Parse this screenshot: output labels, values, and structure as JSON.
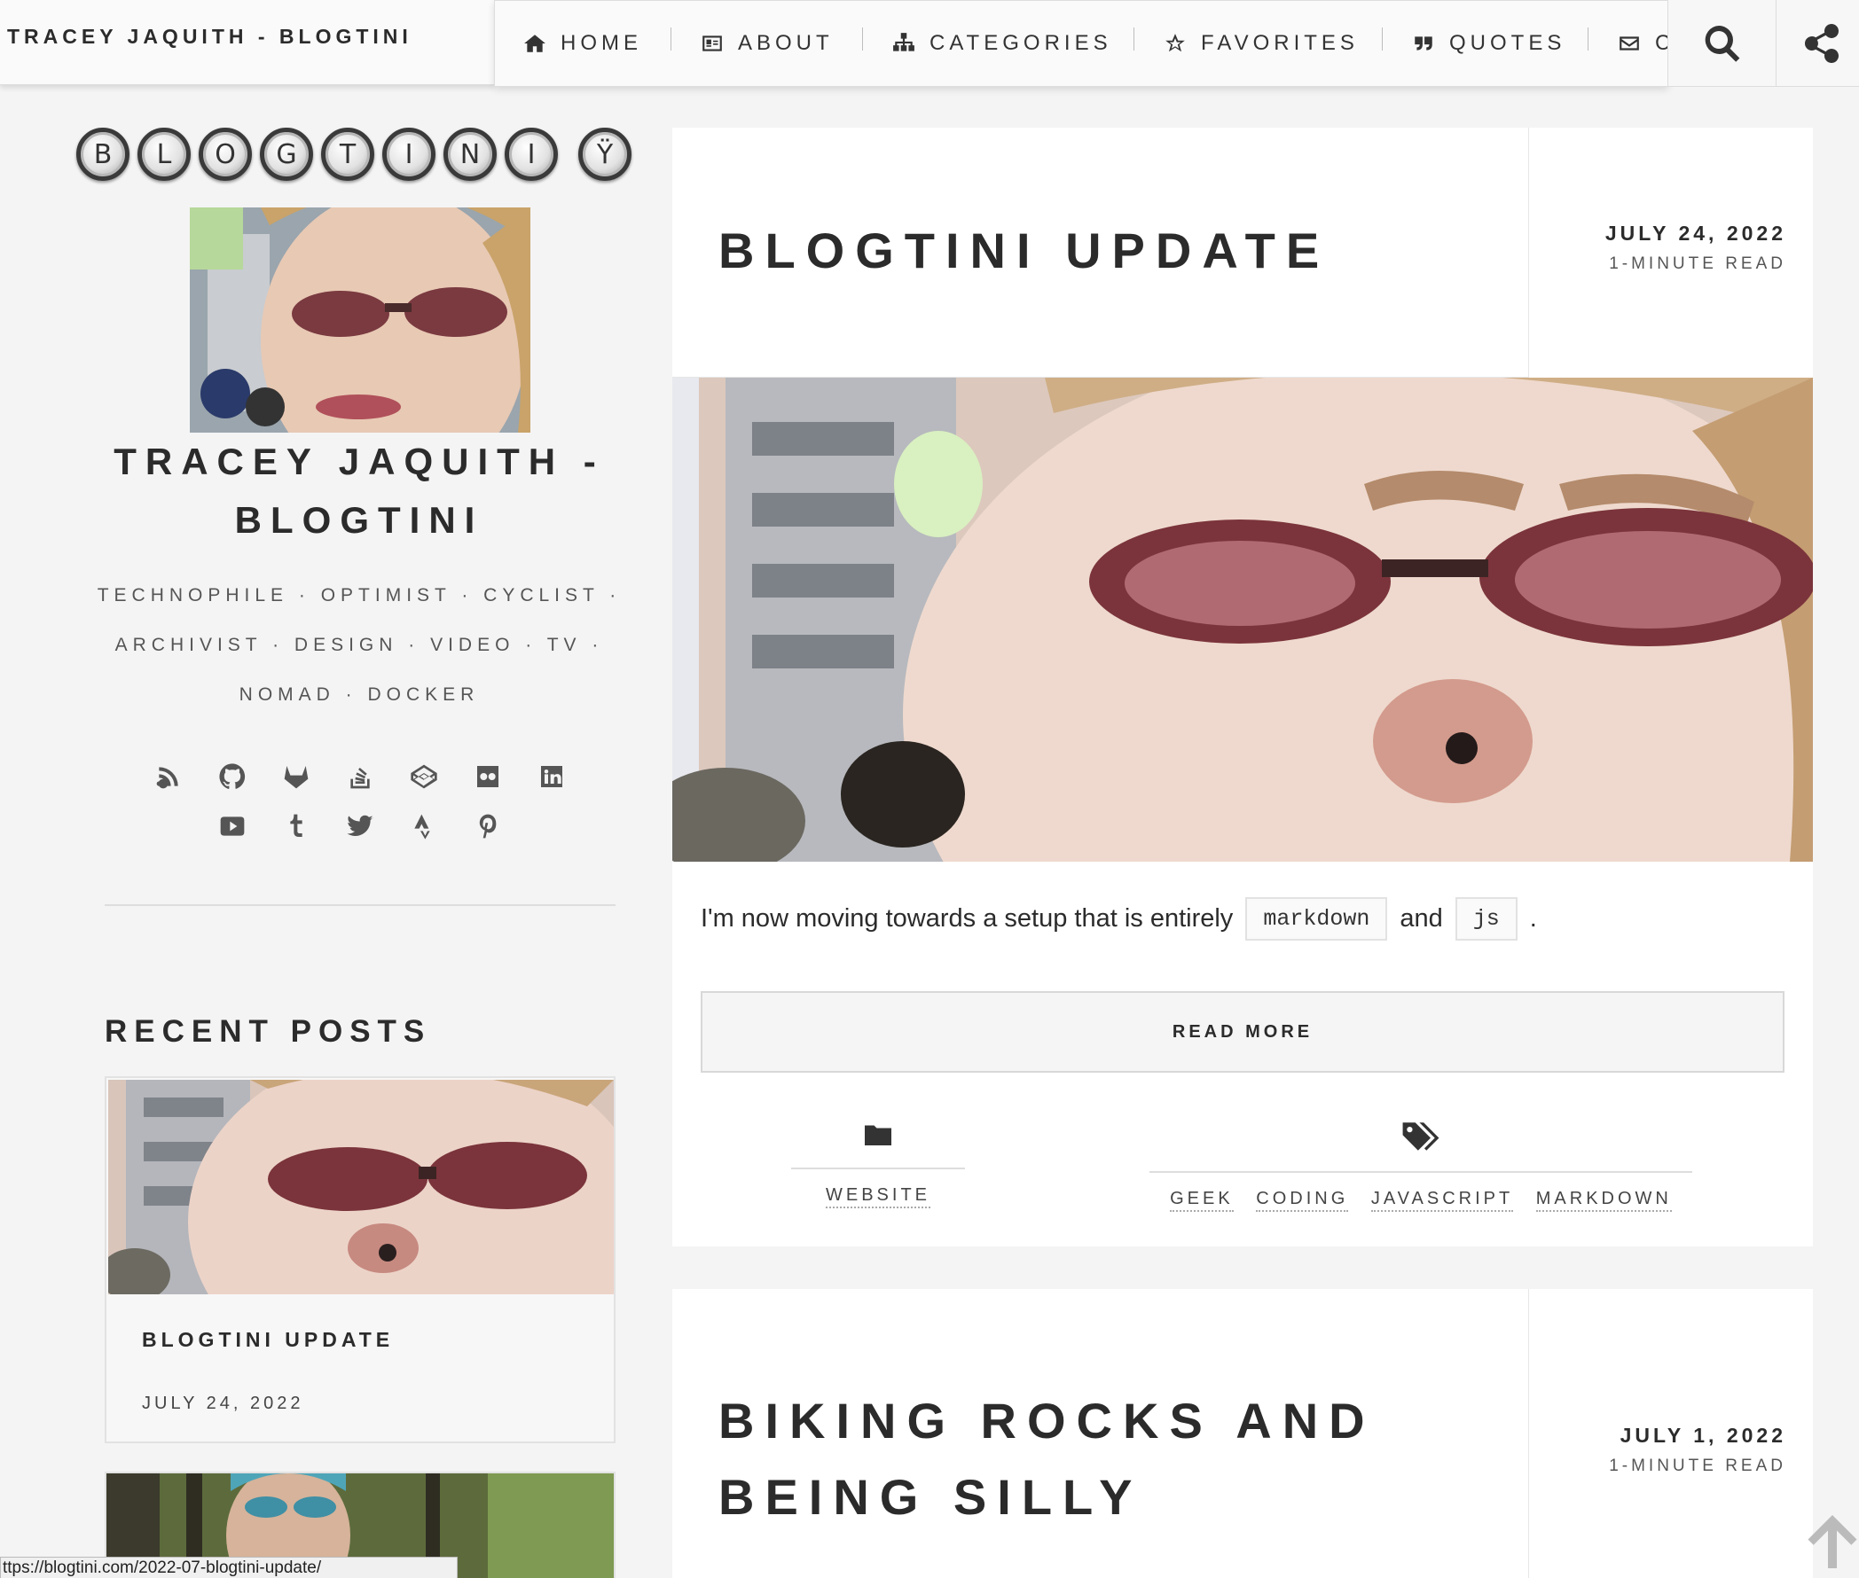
{
  "header": {
    "brand": "TRACEY JAQUITH - BLOGTINI",
    "nav": [
      {
        "label": "HOME",
        "icon": "home-icon"
      },
      {
        "label": "ABOUT",
        "icon": "id-card-icon"
      },
      {
        "label": "CATEGORIES",
        "icon": "sitemap-icon"
      },
      {
        "label": "FAVORITES",
        "icon": "star-icon"
      },
      {
        "label": "QUOTES",
        "icon": "quote-icon"
      },
      {
        "label": "C",
        "icon": "envelope-icon"
      }
    ],
    "search_icon": "search-icon",
    "share_icon": "share-icon"
  },
  "sidebar": {
    "logo_keys": [
      "B",
      "L",
      "O",
      "G",
      "T",
      "I",
      "N",
      "I",
      "Ÿ"
    ],
    "title": "TRACEY JAQUITH - BLOGTINI",
    "tagline": "TECHNOPHILE · OPTIMIST · CYCLIST · ARCHIVIST · DESIGN · VIDEO · TV · NOMAD · DOCKER",
    "social_icons": [
      "rss-icon",
      "github-icon",
      "gitlab-icon",
      "stackoverflow-icon",
      "codepen-icon",
      "flickr-icon",
      "linkedin-icon",
      "youtube-icon",
      "tumblr-icon",
      "twitter-icon",
      "strava-icon",
      "pinterest-icon"
    ],
    "recent_heading": "RECENT POSTS",
    "recent_posts": [
      {
        "title": "BLOGTINI UPDATE",
        "date": "JULY 24, 2022"
      }
    ]
  },
  "posts": [
    {
      "title": "BLOGTINI UPDATE",
      "date": "JULY 24, 2022",
      "read_time": "1-MINUTE READ",
      "excerpt_start": "I'm now moving towards a setup that is entirely",
      "code1": "markdown",
      "excerpt_and": "and",
      "code2": "js",
      "excerpt_end": ".",
      "read_more": "READ MORE",
      "categories": [
        "WEBSITE"
      ],
      "tags": [
        "GEEK",
        "CODING",
        "JAVASCRIPT",
        "MARKDOWN"
      ]
    },
    {
      "title": "BIKING ROCKS AND BEING SILLY",
      "date": "JULY 1, 2022",
      "read_time": "1-MINUTE READ"
    }
  ],
  "status_bar": {
    "url": "ttps://blogtini.com/2022-07-blogtini-update/"
  },
  "colors": {
    "background": "#f4f4f4",
    "card": "#ffffff",
    "text": "#2b2b2b"
  }
}
